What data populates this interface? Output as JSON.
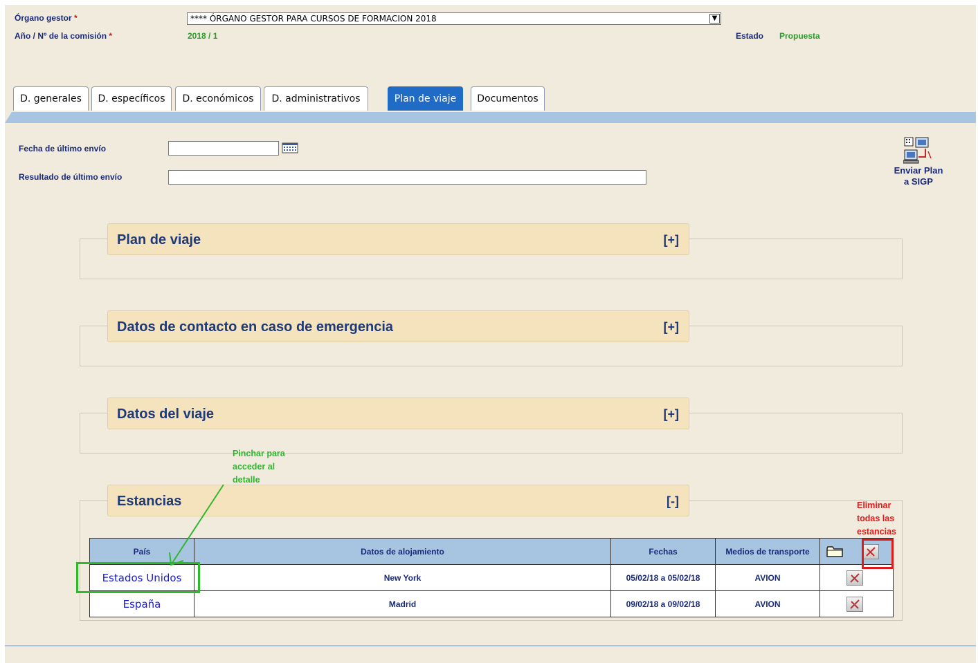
{
  "header": {
    "organo_label": "Órgano gestor",
    "organo_value": "**** ÓRGANO GESTOR PARA CURSOS DE FORMACION 2018",
    "anio_label": "Año / Nº de la comisión",
    "anio_value": "2018 / 1",
    "required_mark": "*",
    "estado_label": "Estado",
    "estado_value": "Propuesta"
  },
  "tabs": [
    {
      "label": "D. generales"
    },
    {
      "label": "D. específicos"
    },
    {
      "label": "D. económicos"
    },
    {
      "label": "D. administrativos"
    },
    {
      "label": "Plan de viaje",
      "active": true
    },
    {
      "label": "Documentos"
    }
  ],
  "form": {
    "fecha_label": "Fecha de último envío",
    "fecha_value": "",
    "resultado_label": "Resultado de último envío",
    "resultado_value": "",
    "send_label_line1": "Enviar Plan",
    "send_label_line2": "a SIGP"
  },
  "sections": [
    {
      "title": "Plan de viaje",
      "toggle": "[+]"
    },
    {
      "title": "Datos de contacto en caso de emergencia",
      "toggle": "[+]"
    },
    {
      "title": "Datos del viaje",
      "toggle": "[+]"
    },
    {
      "title": "Estancias",
      "toggle": "[-]"
    }
  ],
  "table": {
    "headers": [
      "País",
      "Datos de alojamiento",
      "Fechas",
      "Medios de transporte"
    ],
    "rows": [
      {
        "pais": "Estados Unidos",
        "alojamiento": "New York",
        "fechas": "05/02/18 a 05/02/18",
        "transporte": "AVION"
      },
      {
        "pais": "España",
        "alojamiento": "Madrid",
        "fechas": "09/02/18 a 09/02/18",
        "transporte": "AVION"
      }
    ]
  },
  "annotations": {
    "green_note": [
      "Pinchar para",
      "acceder al",
      "detalle"
    ],
    "red_note": [
      "Eliminar",
      "todas las",
      "estancias"
    ]
  },
  "icons": {
    "calendar": "calendar-icon",
    "send": "send-plan-icon",
    "folder": "folder-icon",
    "delete": "delete-icon"
  },
  "colors": {
    "background": "#f1ebdd",
    "accent_blue": "#1f6bc6",
    "table_header": "#a7c4e0",
    "annotation_green": "#2eb82e",
    "annotation_red": "#e01a1a"
  }
}
